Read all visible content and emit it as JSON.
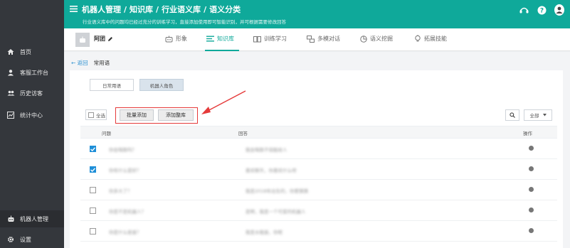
{
  "sidebar": {
    "items": [
      {
        "label": "首页",
        "icon": "home-icon"
      },
      {
        "label": "客服工作台",
        "icon": "agent-icon"
      },
      {
        "label": "历史访客",
        "icon": "users-icon"
      },
      {
        "label": "统计中心",
        "icon": "chart-icon"
      },
      {
        "label": "机器人管理",
        "icon": "robot-icon"
      },
      {
        "label": "设置",
        "icon": "gear-icon"
      }
    ]
  },
  "header": {
    "crumbs": [
      "机器人管理",
      "知识库",
      "行业语义库",
      "语义分类"
    ],
    "separator": "/",
    "subtitle": "行业语义库中的问题均已经过充分的训练学习，直接添加使用即可智能识别，并可根据需要修改回答"
  },
  "robotbar": {
    "robot_name": "阿团",
    "tabs": [
      {
        "label": "形象",
        "icon": "robot-face-icon"
      },
      {
        "label": "知识库",
        "icon": "list-icon"
      },
      {
        "label": "训练学习",
        "icon": "book-icon"
      },
      {
        "label": "多模对话",
        "icon": "dialog-icon"
      },
      {
        "label": "语义挖掘",
        "icon": "mining-icon"
      },
      {
        "label": "拓展技能",
        "icon": "bulb-icon"
      }
    ],
    "active_tab": "知识库"
  },
  "content": {
    "back_label": "← 返回",
    "category": "常用语",
    "subtabs": [
      "日常用语",
      "机器人角色"
    ],
    "active_subtab": "机器人角色",
    "select_all": "全选",
    "batch_add": "批量添加",
    "add_all": "添加整库",
    "filter": "全部",
    "columns": {
      "question": "问题",
      "answer": "回答",
      "action": "操作"
    },
    "rows": [
      {
        "question": "你会唱歌吗？",
        "answer": "我会唱歌不但能给人",
        "checked": true
      },
      {
        "question": "你有什么爱好？",
        "answer": "喜欢聊天，你喜欢什么呀",
        "checked": true
      },
      {
        "question": "你多大了？",
        "answer": "我是2018年出生的，你要猜猜",
        "checked": false
      },
      {
        "question": "你是不是机器人？",
        "answer": "是啊，我是一个可爱的机器人",
        "checked": false
      },
      {
        "question": "你是什么星座？",
        "answer": "我是水瓶座，你呢",
        "checked": false
      }
    ]
  },
  "colors": {
    "brand": "#0fa99a",
    "sidebar": "#34373c",
    "accent_blue": "#1f8fd8",
    "annotation_red": "#e53a3a"
  }
}
